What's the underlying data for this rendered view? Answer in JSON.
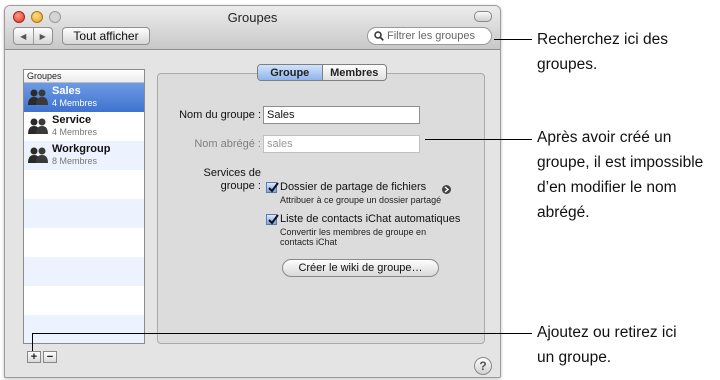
{
  "window": {
    "title": "Groupes"
  },
  "toolbar": {
    "back_icon": "left-arrow-icon",
    "forward_icon": "right-arrow-icon",
    "show_all_label": "Tout afficher",
    "search_placeholder": "Filtrer les groupes"
  },
  "sidebar": {
    "header": "Groupes",
    "groups": [
      {
        "name": "Sales",
        "count": "4 Membres",
        "selected": true
      },
      {
        "name": "Service",
        "count": "4 Membres",
        "selected": false
      },
      {
        "name": "Workgroup",
        "count": "8 Membres",
        "selected": false
      }
    ],
    "add_label": "+",
    "remove_label": "−"
  },
  "tabs": {
    "groupe": "Groupe",
    "membres": "Membres",
    "active": "Groupe"
  },
  "form": {
    "group_name_label": "Nom du groupe :",
    "group_name_value": "Sales",
    "short_name_label": "Nom abrégé :",
    "short_name_value": "sales",
    "services_label_1": "Services de",
    "services_label_2": "groupe :",
    "file_share": {
      "label": "Dossier de partage de fichiers",
      "checked": true,
      "sub": "Attribuer à ce groupe un dossier partagé"
    },
    "ichat": {
      "label": "Liste de contacts iChat automatiques",
      "checked": true,
      "sub_1": "Convertir les membres de groupe en",
      "sub_2": "contacts iChat"
    },
    "wiki_button": "Créer le wiki de groupe…",
    "help_label": "?"
  },
  "callouts": {
    "search_1": "Recherchez ici des",
    "search_2": "groupes.",
    "short_1": "Après avoir créé un",
    "short_2": "groupe, il est impossible",
    "short_3": "d’en modifier le nom",
    "short_4": "abrégé.",
    "add_1": "Ajoutez ou retirez ici",
    "add_2": "un groupe."
  },
  "colors": {
    "selection": "#3f72cf",
    "accent_tab": "#8fb4ec"
  }
}
